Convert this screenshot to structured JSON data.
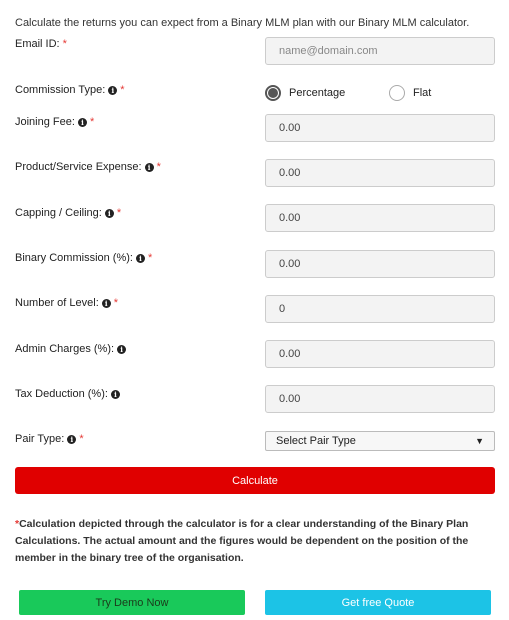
{
  "intro": "Calculate the returns you can expect from a Binary MLM plan with our Binary MLM calculator.",
  "required_mark": "*",
  "info_glyph": "i",
  "fields": {
    "email": {
      "label": "Email ID:",
      "placeholder": "name@domain.com"
    },
    "commission_type": {
      "label": "Commission Type:",
      "options": [
        "Percentage",
        "Flat"
      ],
      "selected": "Percentage"
    },
    "joining_fee": {
      "label": "Joining Fee:",
      "value": "0.00"
    },
    "product_expense": {
      "label": "Product/Service Expense:",
      "value": "0.00"
    },
    "capping": {
      "label": "Capping / Ceiling:",
      "value": "0.00"
    },
    "binary_commission": {
      "label": "Binary Commission (%):",
      "value": "0.00"
    },
    "number_of_level": {
      "label": "Number of Level:",
      "value": "0"
    },
    "admin_charges": {
      "label": "Admin Charges (%):",
      "value": "0.00"
    },
    "tax_deduction": {
      "label": "Tax Deduction (%):",
      "value": "0.00"
    },
    "pair_type": {
      "label": "Pair Type:",
      "selected": "Select Pair Type"
    }
  },
  "buttons": {
    "calculate": "Calculate",
    "demo": "Try Demo Now",
    "quote": "Get free Quote"
  },
  "disclaimer": "Calculation depicted through the calculator is for a clear understanding of the Binary Plan Calculations. The actual amount and the figures would be dependent on the position of the member in the binary tree of the organisation.",
  "colors": {
    "required": "#e53935",
    "calculate_button": "#e00000",
    "demo_button": "#19c95a",
    "quote_button": "#1cc3e6"
  },
  "icons": {
    "info": "info-circle-icon",
    "dropdown": "caret-down-icon"
  }
}
